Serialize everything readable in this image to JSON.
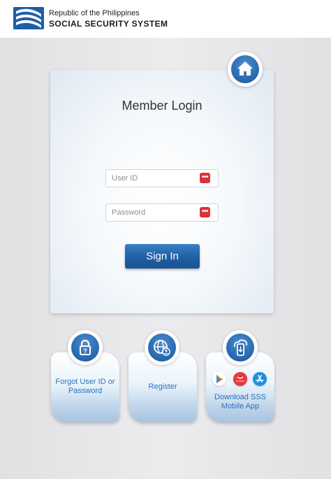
{
  "header": {
    "line1": "Republic of the Philippines",
    "line2": "SOCIAL SECURITY SYSTEM",
    "brand_color": "#1f5ea8"
  },
  "login": {
    "title": "Member Login",
    "user_id_placeholder": "User ID",
    "password_placeholder": "Password",
    "field_icon": "password-manager-icon",
    "signin_label": "Sign In",
    "accent_color": "#2566ad",
    "field_icon_color": "#d9343a"
  },
  "home_icon": "home-icon",
  "tiles": [
    {
      "label": "Forgot User ID or Password",
      "icon": "lock-icon"
    },
    {
      "label": "Register",
      "icon": "globe-user-icon"
    },
    {
      "label": "Download SSS Mobile App",
      "icon": "mobile-cloud-icon",
      "stores": [
        "google-play-icon",
        "huawei-appgallery-icon",
        "app-store-icon"
      ]
    }
  ],
  "store_labels": {
    "huawei": "HUAWEI"
  }
}
